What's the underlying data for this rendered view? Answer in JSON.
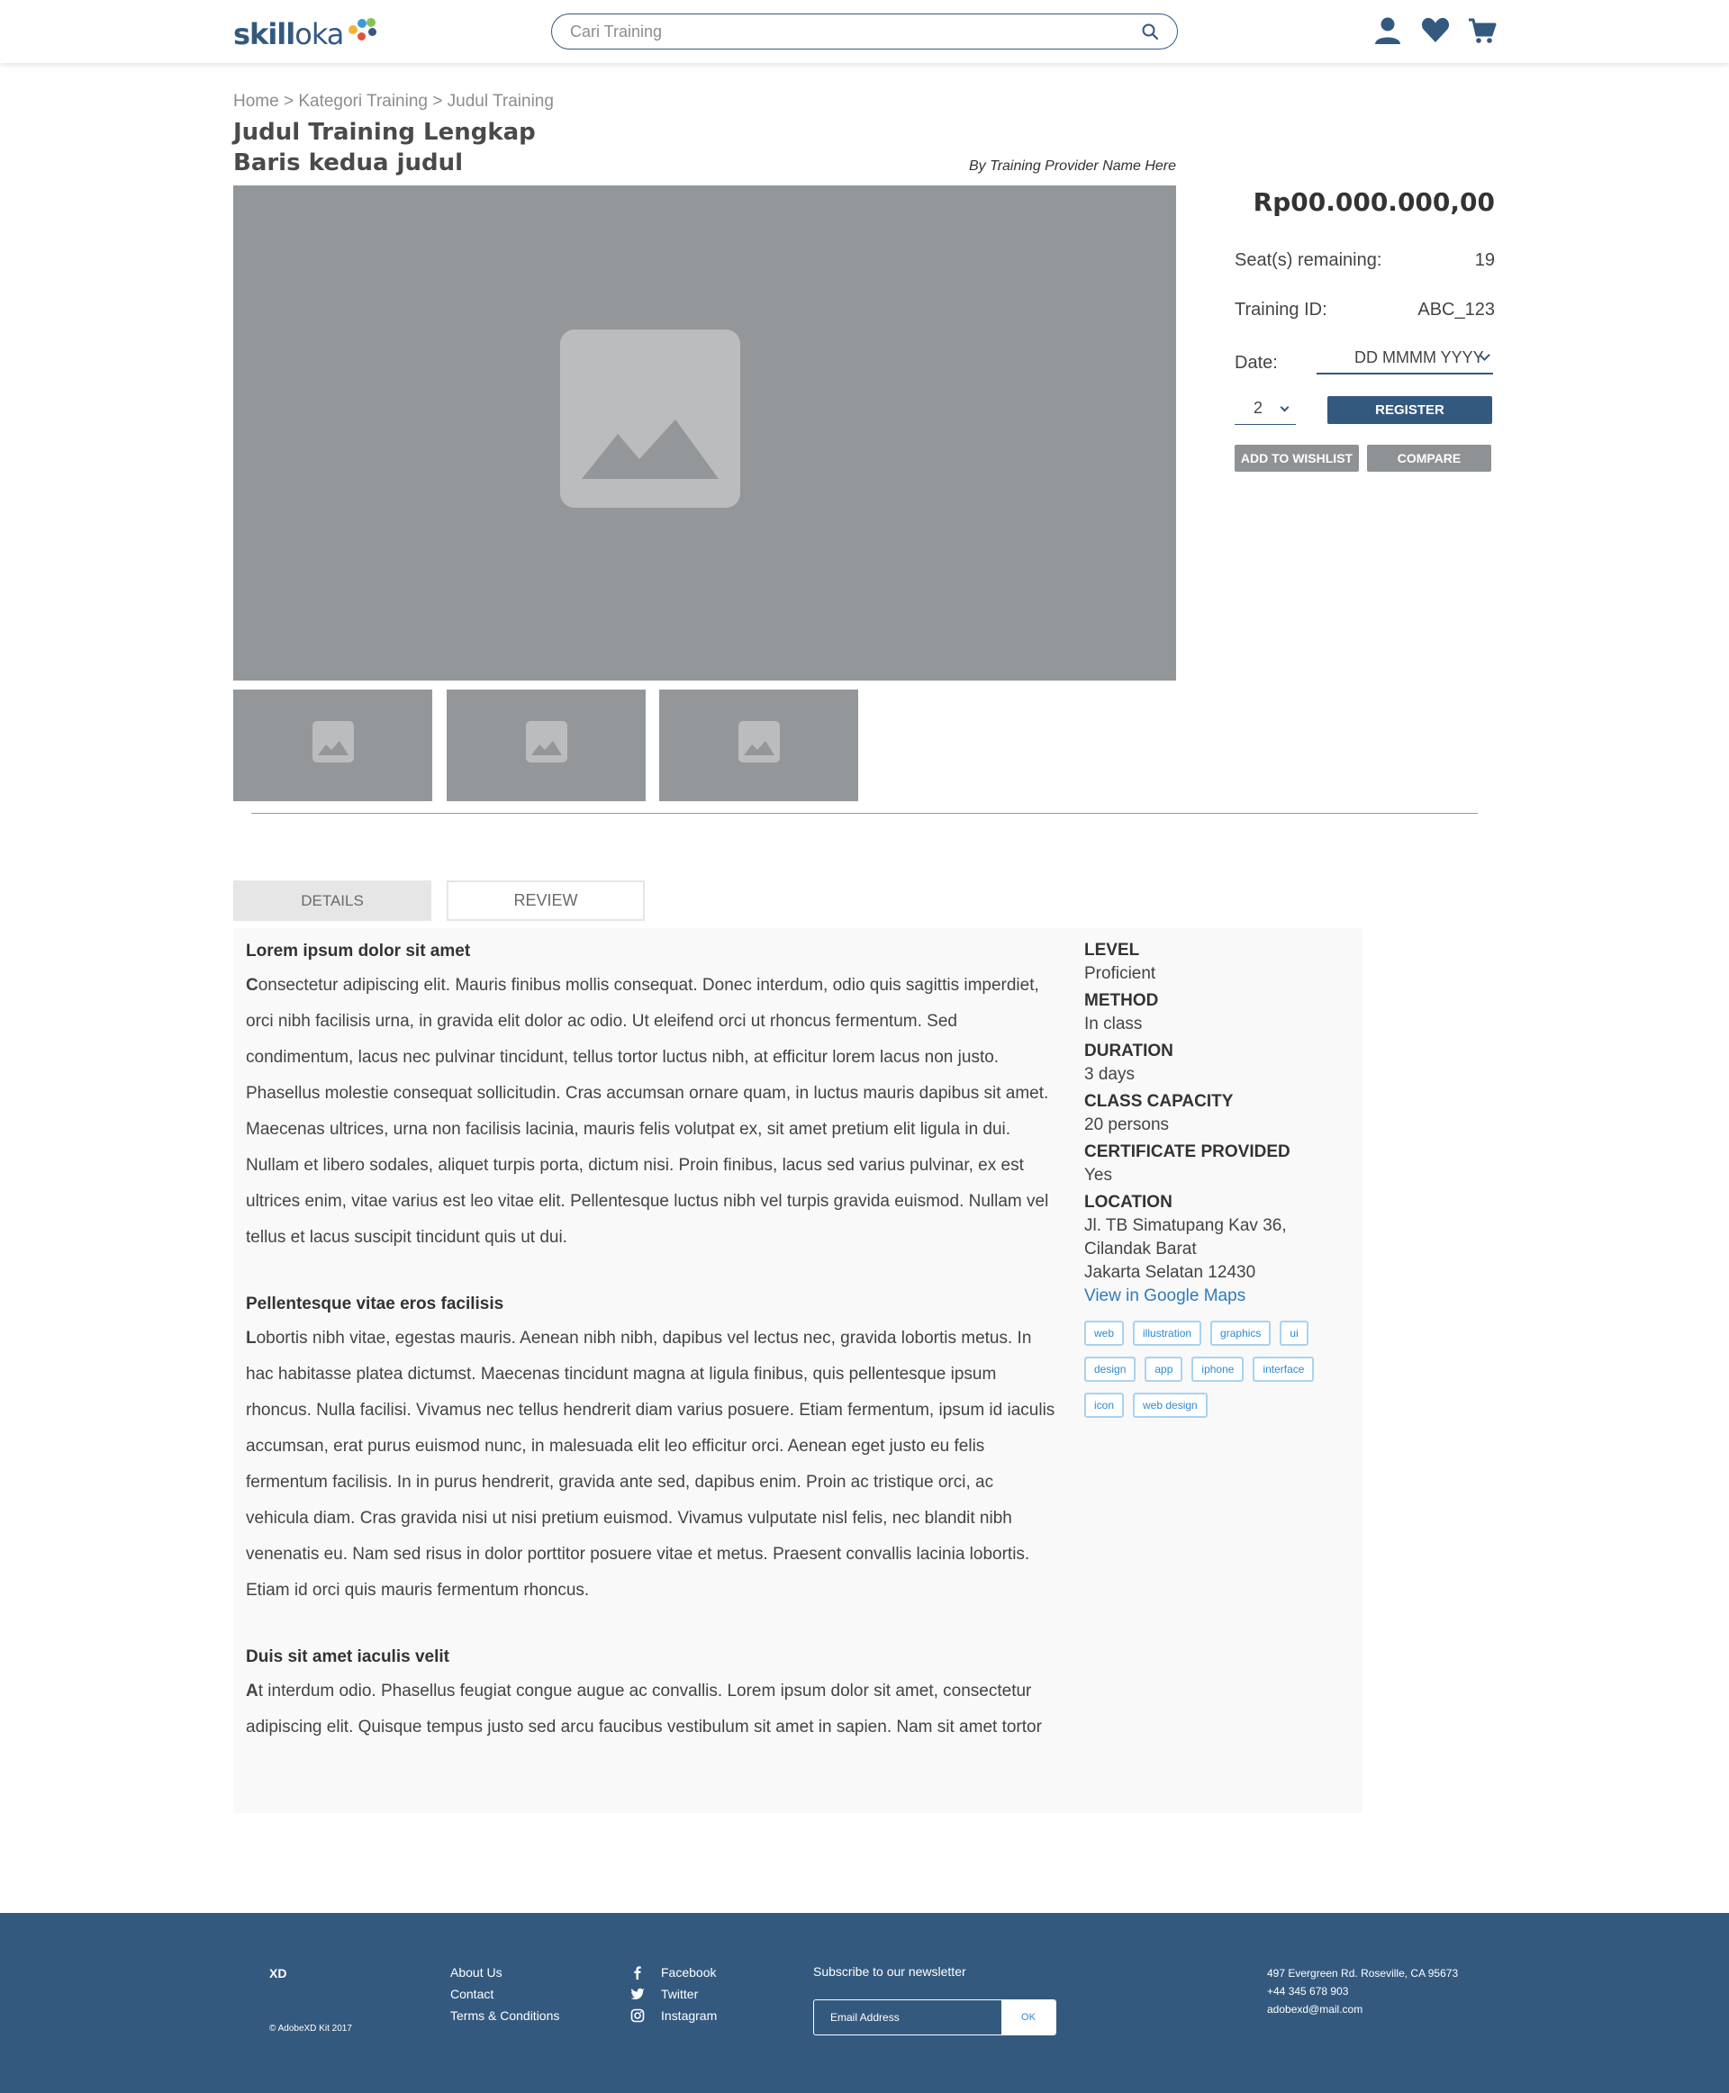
{
  "header": {
    "logo_bold": "skill",
    "logo_light": "oka",
    "search_placeholder": "Cari Training"
  },
  "breadcrumb": "Home > Kategori Training > Judul Training",
  "title_line1": "Judul Training Lengkap",
  "title_line2": "Baris kedua judul",
  "provider": "By Training Provider Name Here",
  "purchase": {
    "price": "Rp00.000.000,00",
    "seats_label": "Seat(s) remaining:",
    "seats_value": "19",
    "id_label": "Training ID:",
    "id_value": "ABC_123",
    "date_label": "Date:",
    "date_value": "DD MMMM YYYY",
    "quantity": "2",
    "register_label": "REGISTER",
    "wishlist_label": "ADD TO WISHLIST",
    "compare_label": "COMPARE"
  },
  "tabs": [
    {
      "label": "DETAILS"
    },
    {
      "label": "REVIEW"
    }
  ],
  "sections": [
    {
      "heading": "Lorem ipsum dolor sit amet",
      "body": "Consectetur adipiscing elit. Mauris finibus mollis consequat. Donec interdum, odio quis sagittis imperdiet, orci nibh facilisis urna, in gravida elit dolor ac odio. Ut eleifend orci ut rhoncus fermentum. Sed condimentum, lacus nec pulvinar tincidunt, tellus tortor luctus nibh, at efficitur lorem lacus non justo. Phasellus molestie consequat sollicitudin. Cras accumsan ornare quam, in luctus mauris dapibus sit amet. Maecenas ultrices, urna non facilisis lacinia, mauris felis volutpat ex, sit amet pretium elit ligula in dui. Nullam et libero sodales, aliquet turpis porta, dictum nisi. Proin finibus, lacus sed varius pulvinar, ex est ultrices enim, vitae varius est leo vitae elit. Pellentesque luctus nibh vel turpis gravida euismod. Nullam vel tellus et lacus suscipit tincidunt quis ut dui."
    },
    {
      "heading": "Pellentesque vitae eros facilisis",
      "body": "Lobortis nibh vitae, egestas mauris. Aenean nibh nibh, dapibus vel lectus nec, gravida lobortis metus. In hac habitasse platea dictumst. Maecenas tincidunt magna at ligula finibus, quis pellentesque ipsum rhoncus. Nulla facilisi. Vivamus nec tellus hendrerit diam varius posuere. Etiam fermentum, ipsum id iaculis accumsan, erat purus euismod nunc, in malesuada elit leo efficitur orci. Aenean eget justo eu felis fermentum facilisis. In in purus hendrerit, gravida ante sed, dapibus enim. Proin ac tristique orci, ac vehicula diam. Cras gravida nisi ut nisi pretium euismod. Vivamus vulputate nisl felis, nec blandit nibh venenatis eu. Nam sed risus in dolor porttitor posuere vitae et metus. Praesent convallis lacinia lobortis. Etiam id orci quis mauris fermentum rhoncus."
    },
    {
      "heading": "Duis sit amet iaculis velit",
      "body": "At interdum odio. Phasellus feugiat congue augue ac convallis. Lorem ipsum dolor sit amet, consectetur adipiscing elit. Quisque tempus justo sed arcu faucibus vestibulum sit amet in sapien. Nam sit amet tortor"
    }
  ],
  "details": {
    "level_label": "LEVEL",
    "level_value": "Proficient",
    "method_label": "METHOD",
    "method_value": "In class",
    "duration_label": "DURATION",
    "duration_value": "3 days",
    "capacity_label": "CLASS CAPACITY",
    "capacity_value": "20 persons",
    "certificate_label": "CERTIFICATE PROVIDED",
    "certificate_value": "Yes",
    "location_label": "LOCATION",
    "location_line1": "Jl. TB Simatupang Kav 36,",
    "location_line2": "Cilandak Barat",
    "location_line3": "Jakarta Selatan 12430",
    "maps_link": "View in Google Maps"
  },
  "tags": [
    "web",
    "illustration",
    "graphics",
    "ui",
    "design",
    "app",
    "iphone",
    "interface",
    "icon",
    "web design"
  ],
  "footer": {
    "brand": "XD",
    "copyright": "© AdobeXD Kit 2017",
    "links": [
      "About Us",
      "Contact",
      "Terms & Conditions"
    ],
    "social": [
      "Facebook",
      "Twitter",
      "Instagram"
    ],
    "newsletter_label": "Subscribe to our newsletter",
    "email_placeholder": "Email Address",
    "ok_label": "OK",
    "address": "497 Evergreen Rd. Roseville, CA 95673",
    "phone": "+44 345 678 903",
    "email": "adobexd@mail.com"
  },
  "colors": {
    "brand_blue": "#34597f",
    "placeholder_grey": "#939799",
    "link_blue": "#2e7bbd",
    "tag_border": "#a8d3ef"
  },
  "icons": [
    "search-icon",
    "user-icon",
    "heart-icon",
    "cart-icon",
    "image-placeholder-icon",
    "facebook-icon",
    "twitter-icon",
    "instagram-icon"
  ]
}
